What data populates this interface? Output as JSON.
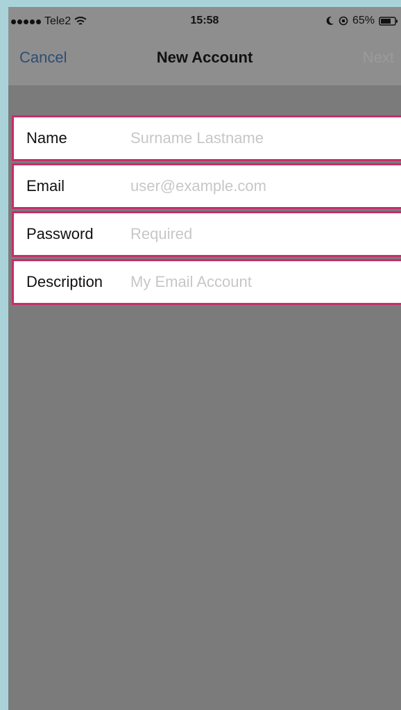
{
  "status_bar": {
    "carrier": "Tele2",
    "time": "15:58",
    "battery_percent": "65%"
  },
  "nav_bar": {
    "cancel_label": "Cancel",
    "title": "New Account",
    "next_label": "Next"
  },
  "form": {
    "rows": [
      {
        "label": "Name",
        "placeholder": "Surname Lastname"
      },
      {
        "label": "Email",
        "placeholder": "user@example.com"
      },
      {
        "label": "Password",
        "placeholder": "Required"
      },
      {
        "label": "Description",
        "placeholder": "My Email Account"
      }
    ]
  },
  "colors": {
    "accent": "#c62e6c",
    "cancel": "#2e4d72",
    "disabled": "#9b9b9b",
    "placeholder": "#c7c7c7",
    "overlay": "#7b7b7b",
    "background": "#a9d3d9"
  },
  "icons": [
    "signal-dots-icon",
    "wifi-icon",
    "moon-icon",
    "rotation-lock-icon",
    "battery-icon"
  ]
}
